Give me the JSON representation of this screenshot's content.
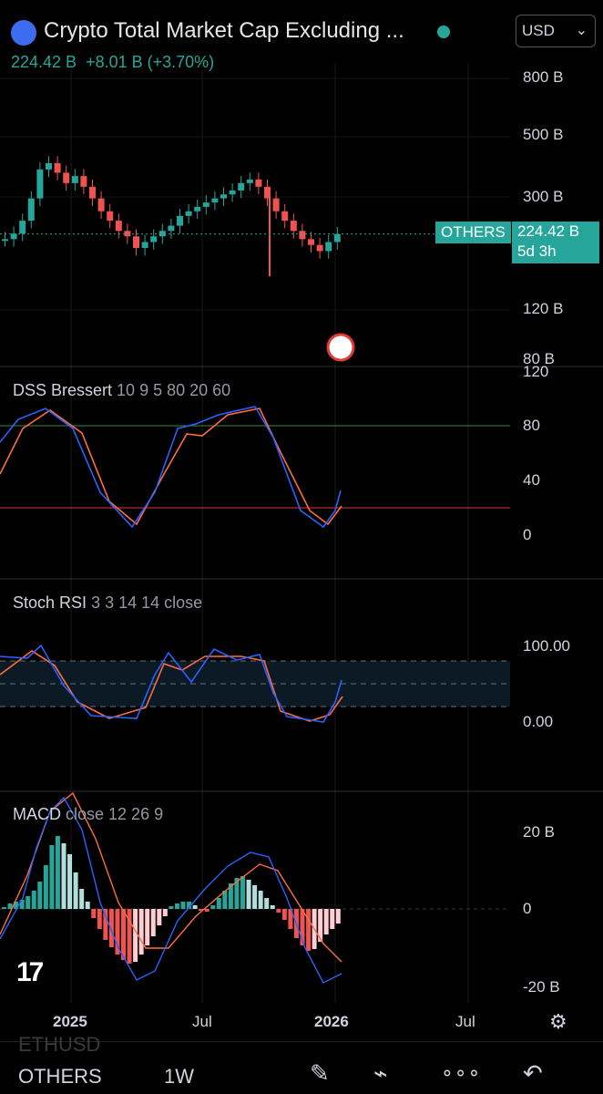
{
  "header": {
    "title": "Crypto Total Market Cap Excluding ...",
    "value": "224.42 B",
    "change": "+8.01 B (+3.70%)",
    "currency": "USD"
  },
  "price_axis": [
    "800 B",
    "500 B",
    "300 B",
    "224.42 B",
    "120 B",
    "80 B"
  ],
  "price_badge": {
    "symbol": "OTHERS",
    "price": "224.42 B",
    "countdown": "5d 3h"
  },
  "dss": {
    "title": "DSS Bressert",
    "params": "10 9 5 80 20 60",
    "axis": [
      "120",
      "80",
      "40",
      "0"
    ]
  },
  "stoch": {
    "title": "Stoch RSI",
    "params": "3 3 14 14 close",
    "axis": [
      "100.00",
      "0.00"
    ]
  },
  "macd": {
    "title": "MACD",
    "params": "close 12 26 9",
    "axis": [
      "20 B",
      "0",
      "-20 B"
    ]
  },
  "time_axis": [
    "2025",
    "Jul",
    "2026",
    "Jul"
  ],
  "bottom_bar": {
    "symbol": "OTHERS",
    "interval": "1W",
    "faded_symbol": "ETHUSD"
  },
  "colors": {
    "up": "#26a69a",
    "down": "#ef5350",
    "fast": "#2962ff",
    "slow": "#ff6d3f"
  },
  "chart_data": {
    "type": "line",
    "title": "OTHERS 1W",
    "series": [
      {
        "name": "OTHERS",
        "values": [
          215,
          225,
          250,
          300,
          380,
          400,
          370,
          340,
          360,
          330,
          300,
          270,
          250,
          230,
          220,
          200,
          210,
          220,
          230,
          240,
          260,
          270,
          280,
          290,
          300,
          310,
          320,
          340,
          350,
          330,
          300,
          270,
          250,
          230,
          215,
          205,
          195,
          210,
          224
        ]
      }
    ]
  }
}
